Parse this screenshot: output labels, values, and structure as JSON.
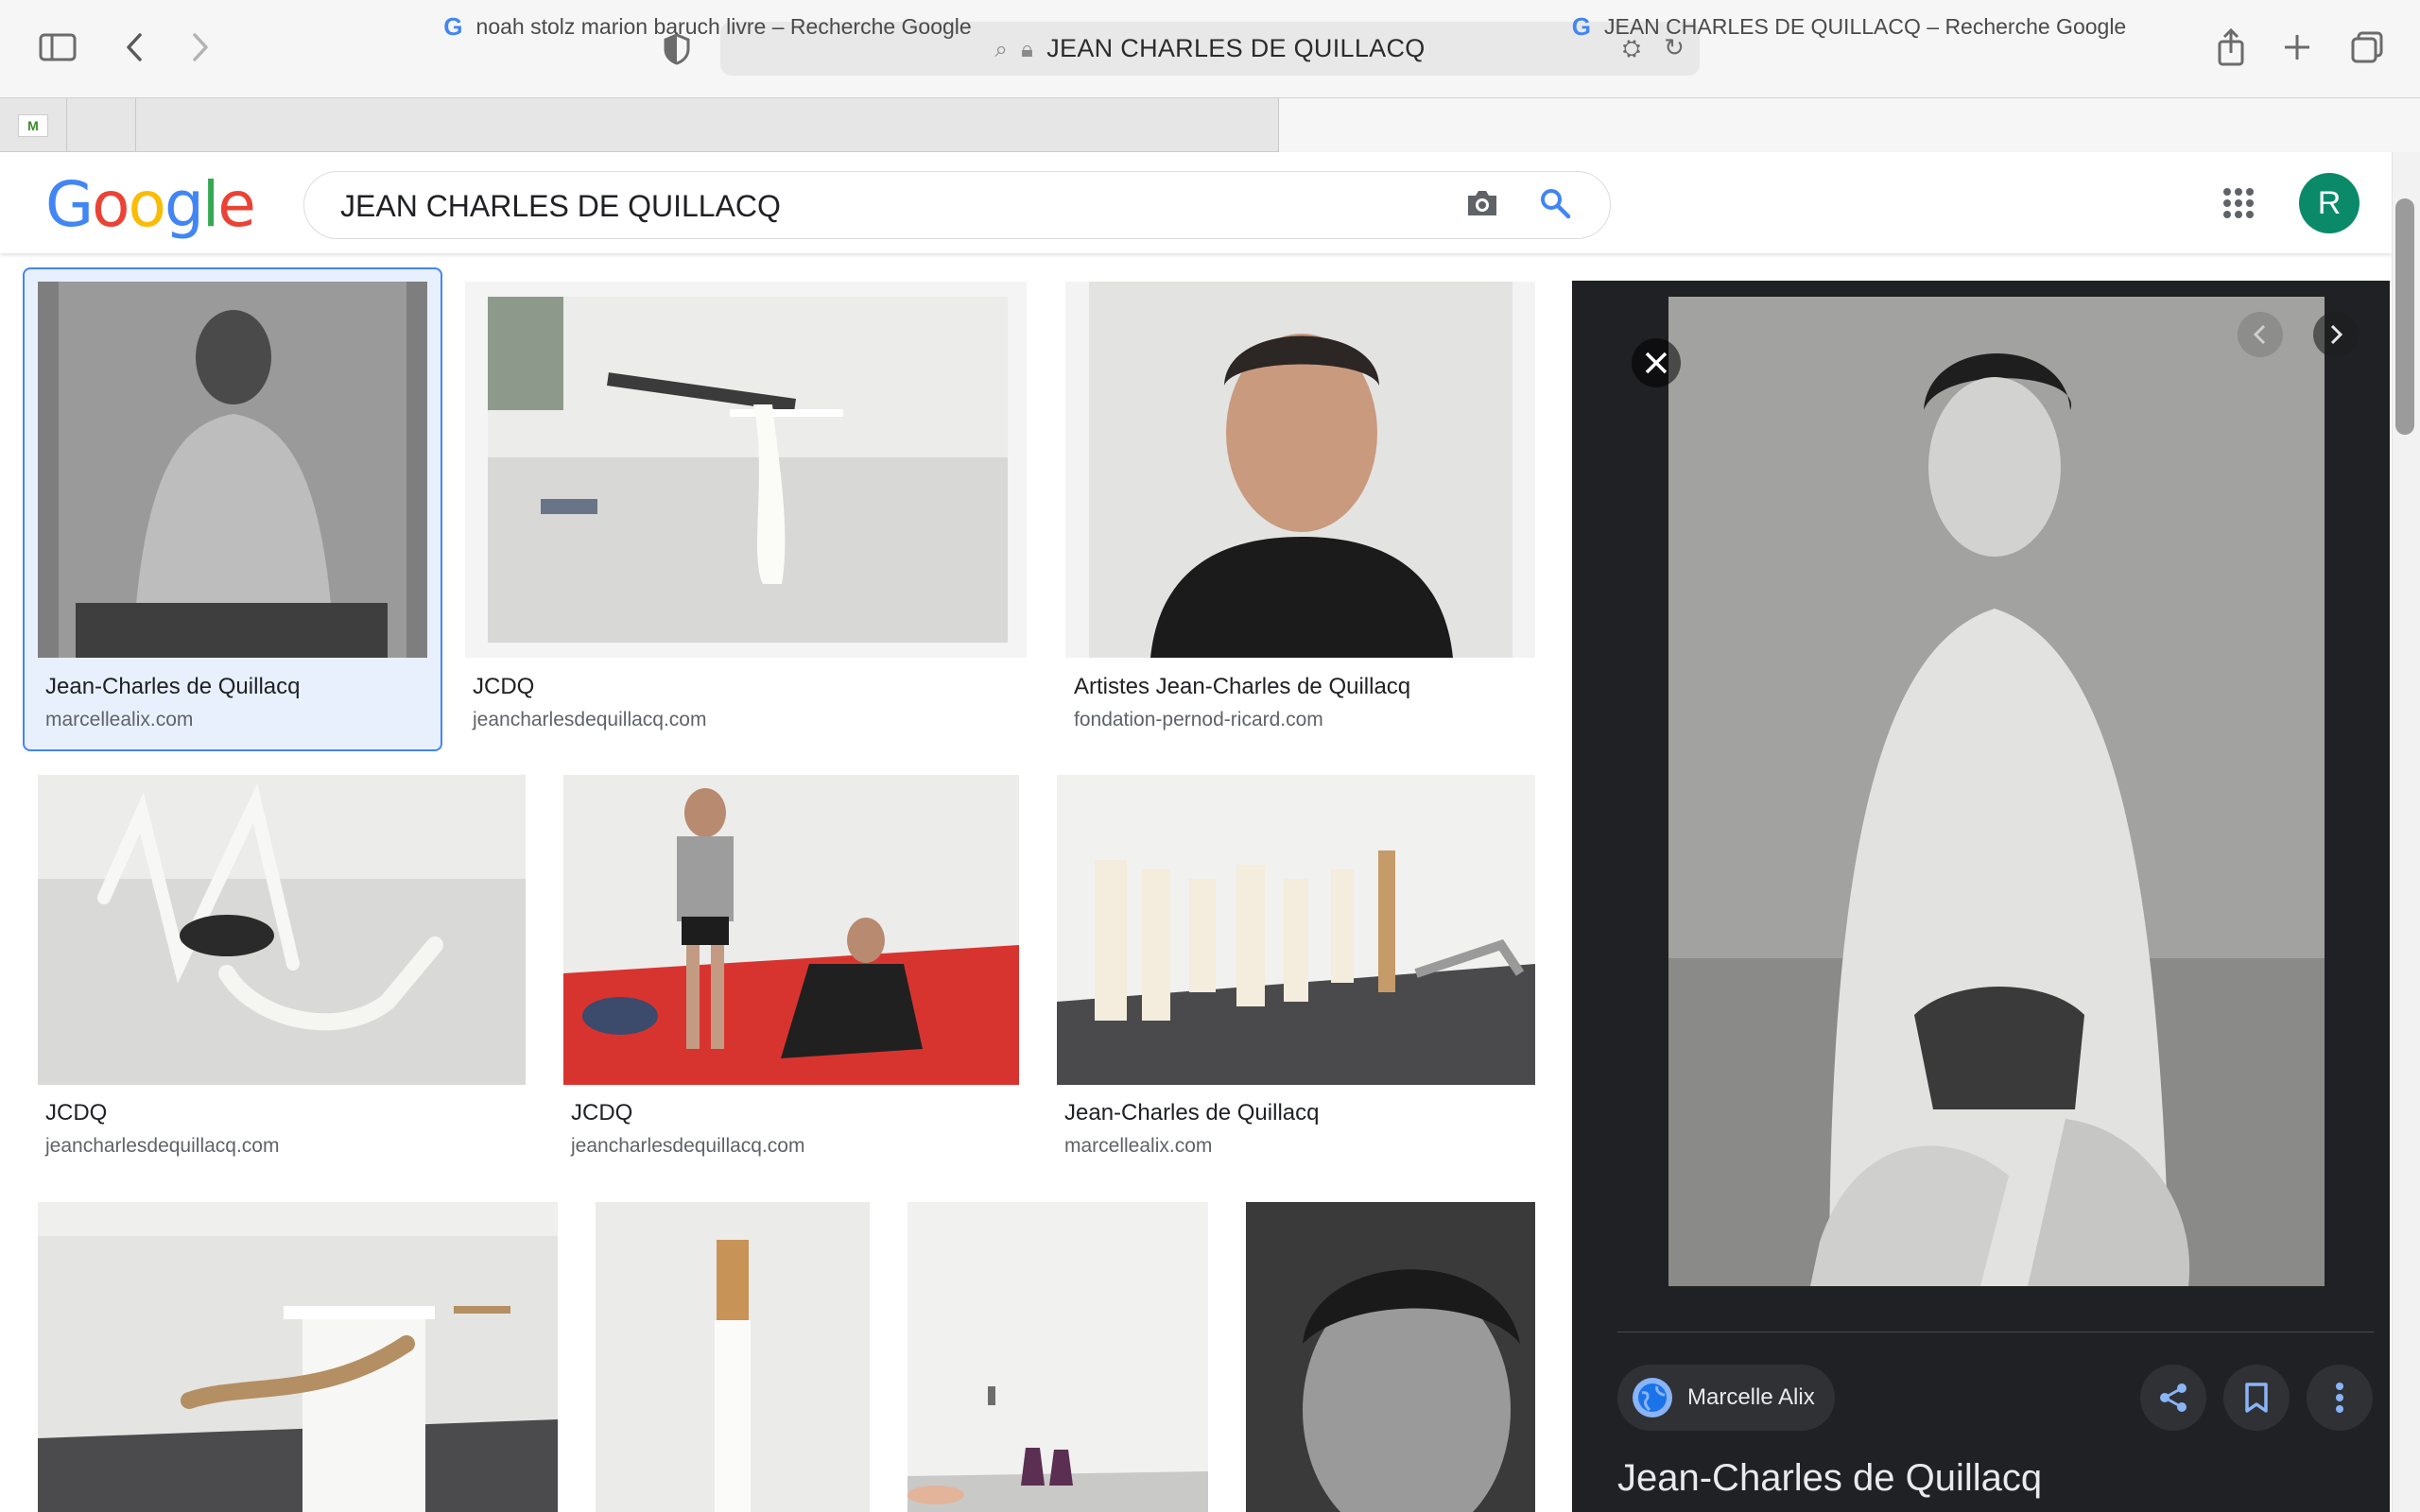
{
  "browser": {
    "address_text": "JEAN CHARLES DE QUILLACQ",
    "tabs": [
      {
        "label": "noah stolz marion baruch livre – Recherche Google"
      },
      {
        "label": "JEAN CHARLES DE QUILLACQ – Recherche Google"
      }
    ]
  },
  "google": {
    "logo": {
      "G": "G",
      "o1": "o",
      "o2": "o",
      "g": "g",
      "l": "l",
      "e": "e"
    },
    "query": "JEAN CHARLES DE QUILLACQ",
    "avatar_letter": "R",
    "colors": {
      "blue": "#4285f4",
      "red": "#ea4335",
      "yellow": "#fbbc05",
      "green": "#34a853"
    }
  },
  "results": [
    {
      "title": "Jean-Charles de Quillacq",
      "site": "marcellealix.com"
    },
    {
      "title": "JCDQ",
      "site": "jeancharlesdequillacq.com"
    },
    {
      "title": "Artistes Jean-Charles de Quillacq",
      "site": "fondation-pernod-ricard.com"
    },
    {
      "title": "JCDQ",
      "site": "jeancharlesdequillacq.com"
    },
    {
      "title": "JCDQ",
      "site": "jeancharlesdequillacq.com"
    },
    {
      "title": "Jean-Charles de Quillacq",
      "site": "marcellealix.com"
    }
  ],
  "preview": {
    "source_name": "Marcelle Alix",
    "title": "Jean-Charles de Quillacq"
  }
}
